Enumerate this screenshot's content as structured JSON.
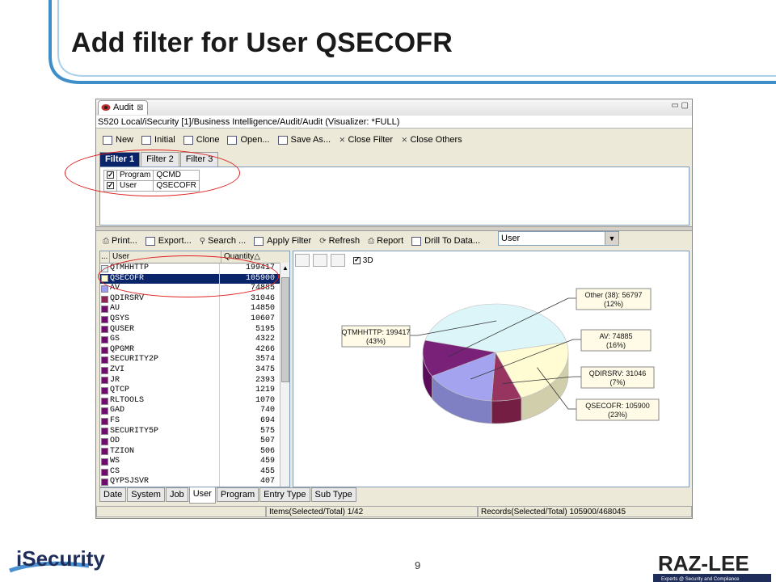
{
  "slide": {
    "title": "Add filter for User QSECOFR",
    "page_number": "9",
    "footer_logo_left": "iSecurity",
    "footer_logo_right": "RAZ-LEE",
    "footer_logo_right_tagline": "Experts @ Security and Compliance"
  },
  "window": {
    "view_tab": "Audit",
    "view_tab_close": "⊠",
    "window_controls": "▭ ▢",
    "breadcrumb": "S520 Local/iSecurity [1]/Business Intelligence/Audit/Audit (Visualizer: *FULL)"
  },
  "toolbar": [
    {
      "label": "New",
      "icon": "new-icon"
    },
    {
      "label": "Initial",
      "icon": "initial-icon"
    },
    {
      "label": "Clone",
      "icon": "clone-icon"
    },
    {
      "label": "Open...",
      "icon": "open-icon"
    },
    {
      "label": "Save As...",
      "icon": "save-icon"
    },
    {
      "label": "Close Filter",
      "icon": "close-icon"
    },
    {
      "label": "Close Others",
      "icon": "close-icon"
    }
  ],
  "filter_tabs": [
    "Filter 1",
    "Filter 2",
    "Filter 3"
  ],
  "filters": [
    {
      "checked": true,
      "field": "Program",
      "value": "QCMD"
    },
    {
      "checked": true,
      "field": "User",
      "value": "QSECOFR"
    }
  ],
  "toolbar2": [
    {
      "label": "Print...",
      "icon": "print-icon"
    },
    {
      "label": "Export...",
      "icon": "export-icon"
    },
    {
      "label": "Search ...",
      "icon": "search-icon"
    },
    {
      "label": "Apply Filter",
      "icon": "filter-icon"
    },
    {
      "label": "Refresh",
      "icon": "refresh-icon"
    },
    {
      "label": "Report",
      "icon": "report-icon"
    },
    {
      "label": "Drill To Data...",
      "icon": "drill-icon"
    }
  ],
  "group_by": {
    "selected": "User",
    "arrow": "▼"
  },
  "grid": {
    "columns": [
      "...",
      "User",
      "Quantity"
    ],
    "sort_indicator": "△",
    "rows": [
      {
        "user": "QTMHHTTP",
        "qty": "199417",
        "color": "#d9f4f8"
      },
      {
        "user": "QSECOFR",
        "qty": "105900",
        "color": "#fffcd0",
        "selected": true
      },
      {
        "user": "AV",
        "qty": "74885",
        "color": "#9b9bef"
      },
      {
        "user": "QDIRSRV",
        "qty": "31046",
        "color": "#8e2453"
      },
      {
        "user": "AU",
        "qty": "14850",
        "color": "#6e0d6e"
      },
      {
        "user": "QSYS",
        "qty": "10607",
        "color": "#6e0d6e"
      },
      {
        "user": "QUSER",
        "qty": "5195",
        "color": "#6e0d6e"
      },
      {
        "user": "GS",
        "qty": "4322",
        "color": "#6e0d6e"
      },
      {
        "user": "QPGMR",
        "qty": "4266",
        "color": "#6e0d6e"
      },
      {
        "user": "SECURITY2P",
        "qty": "3574",
        "color": "#6e0d6e"
      },
      {
        "user": "ZVI",
        "qty": "3475",
        "color": "#6e0d6e"
      },
      {
        "user": "JR",
        "qty": "2393",
        "color": "#6e0d6e"
      },
      {
        "user": "QTCP",
        "qty": "1219",
        "color": "#6e0d6e"
      },
      {
        "user": "RLTOOLS",
        "qty": "1070",
        "color": "#6e0d6e"
      },
      {
        "user": "GAD",
        "qty": "740",
        "color": "#6e0d6e"
      },
      {
        "user": "FS",
        "qty": "694",
        "color": "#6e0d6e"
      },
      {
        "user": "SECURITY5P",
        "qty": "575",
        "color": "#6e0d6e"
      },
      {
        "user": "OD",
        "qty": "507",
        "color": "#6e0d6e"
      },
      {
        "user": "TZION",
        "qty": "506",
        "color": "#6e0d6e"
      },
      {
        "user": "WS",
        "qty": "459",
        "color": "#6e0d6e"
      },
      {
        "user": "CS",
        "qty": "455",
        "color": "#6e0d6e"
      },
      {
        "user": "QYPSJSVR",
        "qty": "407",
        "color": "#6e0d6e"
      }
    ]
  },
  "chart_toolbar": {
    "checkbox_label": "3D",
    "checked": true
  },
  "chart_data": {
    "type": "pie",
    "style": "3d",
    "slices": [
      {
        "label": "QTMHHTTP: 199417 (43%)",
        "value": 199417,
        "percent": 43,
        "color": "#d9f4f8"
      },
      {
        "label": "QSECOFR: 105900 (23%)",
        "value": 105900,
        "percent": 23,
        "color": "#fffcd0"
      },
      {
        "label": "QDIRSRV: 31046 (7%)",
        "value": 31046,
        "percent": 7,
        "color": "#8e2453"
      },
      {
        "label": "AV: 74885 (16%)",
        "value": 74885,
        "percent": 16,
        "color": "#9b9bef"
      },
      {
        "label": "Other (38): 56797 (12%)",
        "value": 56797,
        "percent": 12,
        "color": "#6e0d6e"
      }
    ]
  },
  "bottom_tabs": [
    "Date",
    "System",
    "Job",
    "User",
    "Program",
    "Entry Type",
    "Sub Type"
  ],
  "active_bottom_tab": "User",
  "status": {
    "items": "Items(Selected/Total) 1/42",
    "records": "Records(Selected/Total) 105900/468045"
  },
  "colors": {
    "title_text": "#1a1a1a",
    "frame_blue": "#3d8ec9",
    "selection": "#0a246a",
    "annotation": "#e02020"
  }
}
